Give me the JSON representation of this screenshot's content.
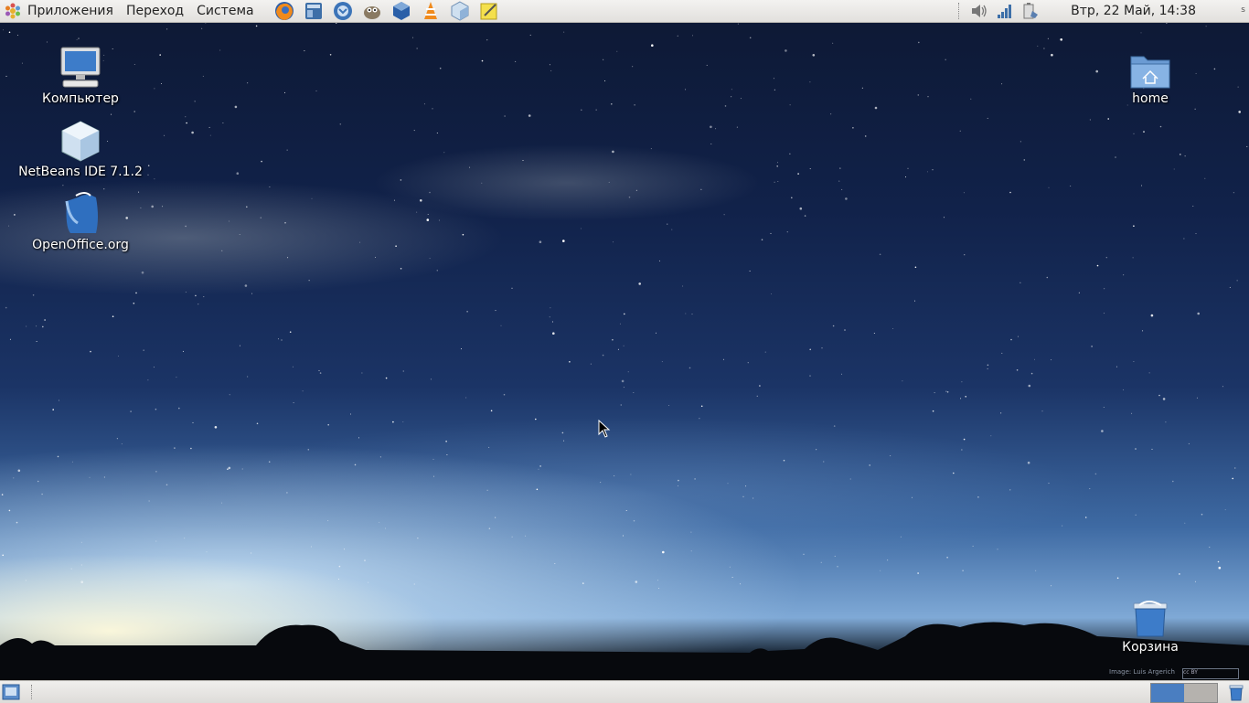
{
  "top_panel": {
    "menus": [
      "Приложения",
      "Переход",
      "Система"
    ],
    "launchers": [
      "firefox-icon",
      "file-manager-icon",
      "thunderbird-icon",
      "gimp-icon",
      "virtualbox-icon",
      "vlc-icon",
      "netbeans-icon",
      "notes-icon"
    ],
    "tray_icons": [
      "volume-icon",
      "network-icon",
      "battery-icon"
    ],
    "clock": "Втр, 22 Май, 14:38"
  },
  "desktop_icons": {
    "computer": "Компьютер",
    "netbeans": "NetBeans IDE 7.1.2",
    "openoffice": "OpenOffice.org",
    "home": "home",
    "trash": "Корзина"
  },
  "wallpaper": {
    "credit": "Image: Luis Argerich",
    "license": "cc BY"
  },
  "bottom_panel": {
    "workspaces": 2,
    "active_workspace": 1
  },
  "colors": {
    "panel": "#e6e4e1",
    "sky_top": "#0d1833",
    "horizon_glow": "#fff8d8",
    "workspace_active": "#4a7ec1"
  }
}
